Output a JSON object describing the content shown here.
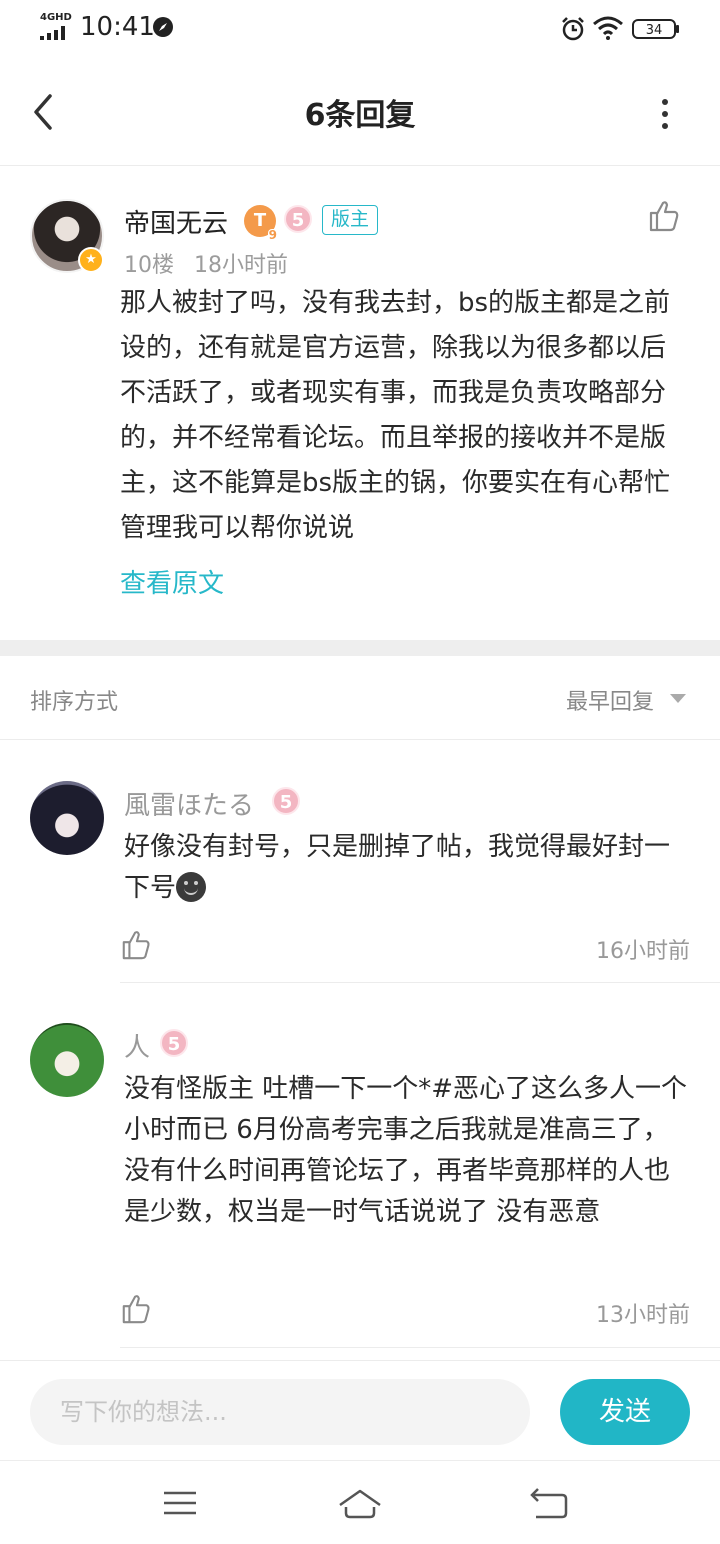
{
  "status_bar": {
    "network": "4GHD",
    "time": "10:41",
    "battery": "34"
  },
  "header": {
    "title": "6条回复"
  },
  "main_post": {
    "username": "帝国无云",
    "level_letter": "T",
    "level_number": "9",
    "rank": "5",
    "role": "版主",
    "floor": "10楼",
    "time": "18小时前",
    "content": "那人被封了吗，没有我去封，bs的版主都是之前设的，还有就是官方运营，除我以为很多都以后不活跃了，或者现实有事，而我是负责攻略部分的，并不经常看论坛。而且举报的接收并不是版主，这不能算是bs版主的锅，你要实在有心帮忙管理我可以帮你说说",
    "view_original": "查看原文"
  },
  "sort": {
    "label": "排序方式",
    "selected": "最早回复"
  },
  "replies": [
    {
      "name": "風雷ほたる",
      "rank": "5",
      "text": "好像没有封号，只是删掉了帖，我觉得最好封一下号",
      "emoji": "smile-emoji",
      "time": "16小时前"
    },
    {
      "name": "人",
      "rank": "5",
      "text": "没有怪版主 吐槽一下一个*#恶心了这么多人一个小时而已 6月份高考完事之后我就是准高三了，没有什么时间再管论坛了，再者毕竟那样的人也是少数，权当是一时气话说说了 没有恶意",
      "time": "13小时前"
    }
  ],
  "composer": {
    "placeholder": "写下你的想法...",
    "send_label": "发送"
  },
  "colors": {
    "accent": "#21b6c6",
    "badge_orange": "#f49a4a",
    "badge_pink": "#f3b6c2",
    "meta_gray": "#999999"
  },
  "icons": {
    "back": "chevron-left-icon",
    "more": "more-vertical-icon",
    "like": "thumbs-up-icon",
    "menu": "menu-icon",
    "home": "home-icon",
    "return": "return-icon"
  }
}
